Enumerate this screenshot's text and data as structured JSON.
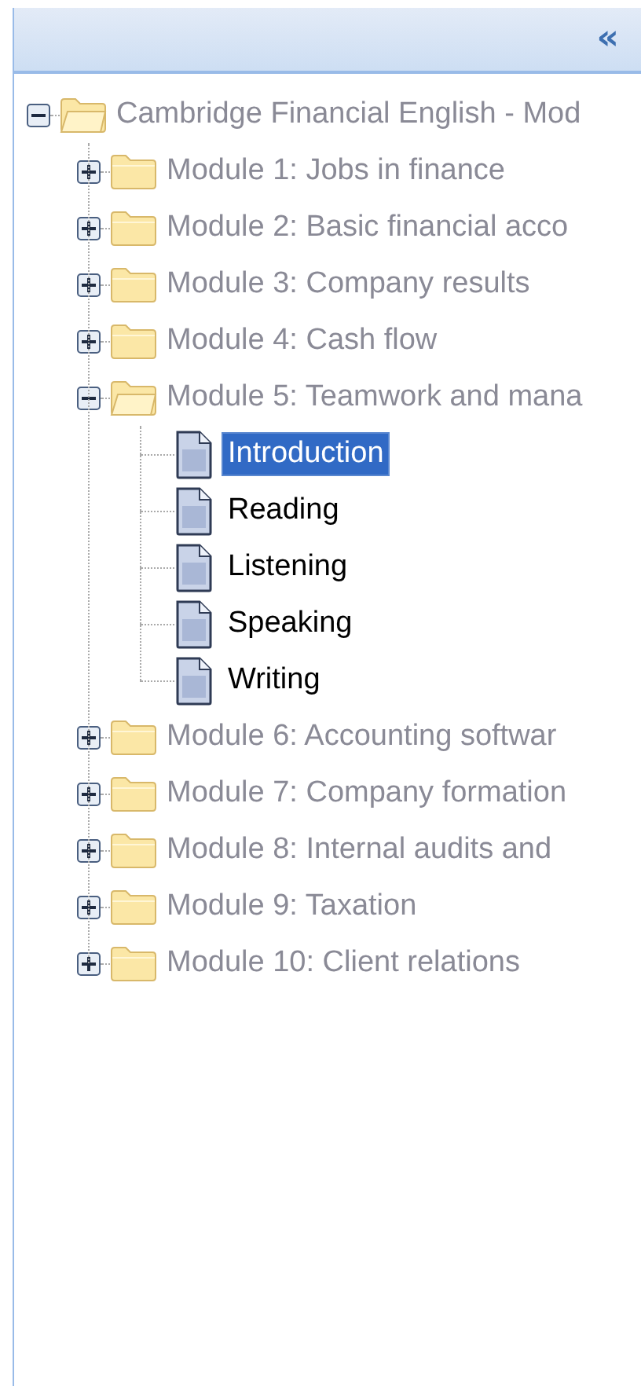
{
  "panel": {
    "collapse_button": "«"
  },
  "tree": [
    {
      "kind": "folder",
      "label": "Cambridge Financial English - Mod",
      "expanded": true,
      "children": [
        {
          "kind": "folder",
          "label": "Module 1: Jobs in finance",
          "expanded": false
        },
        {
          "kind": "folder",
          "label": "Module 2: Basic financial acco",
          "expanded": false
        },
        {
          "kind": "folder",
          "label": "Module 3: Company results",
          "expanded": false
        },
        {
          "kind": "folder",
          "label": "Module 4: Cash flow",
          "expanded": false
        },
        {
          "kind": "folder",
          "label": "Module 5: Teamwork and mana",
          "expanded": true,
          "children": [
            {
              "kind": "page",
              "label": "Introduction",
              "selected": true
            },
            {
              "kind": "page",
              "label": "Reading",
              "selected": false
            },
            {
              "kind": "page",
              "label": "Listening",
              "selected": false
            },
            {
              "kind": "page",
              "label": "Speaking",
              "selected": false
            },
            {
              "kind": "page",
              "label": "Writing",
              "selected": false
            }
          ]
        },
        {
          "kind": "folder",
          "label": "Module 6: Accounting softwar",
          "expanded": false
        },
        {
          "kind": "folder",
          "label": "Module 7: Company formation",
          "expanded": false
        },
        {
          "kind": "folder",
          "label": "Module 8: Internal audits and",
          "expanded": false
        },
        {
          "kind": "folder",
          "label": "Module 9: Taxation",
          "expanded": false
        },
        {
          "kind": "folder",
          "label": "Module 10: Client relations",
          "expanded": false
        }
      ]
    }
  ]
}
